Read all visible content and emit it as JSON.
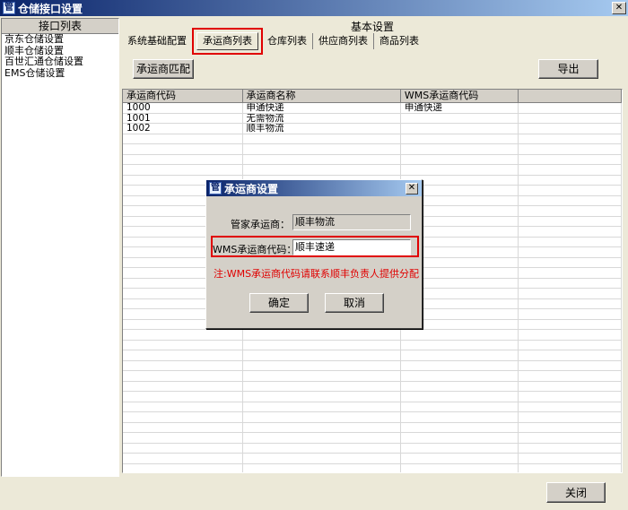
{
  "window": {
    "title": "仓储接口设置",
    "close_glyph": "✕"
  },
  "left_panel": {
    "header": "接口列表",
    "items": [
      "京东仓储设置",
      "顺丰仓储设置",
      "百世汇通仓储设置",
      "EMS仓储设置"
    ]
  },
  "main": {
    "section_title": "基本设置",
    "tabs": [
      {
        "label": "系统基础配置",
        "active": false
      },
      {
        "label": "承运商列表",
        "active": true
      },
      {
        "label": "仓库列表",
        "active": false
      },
      {
        "label": "供应商列表",
        "active": false
      },
      {
        "label": "商品列表",
        "active": false
      }
    ],
    "match_button": "承运商匹配",
    "export_button": "导出",
    "close_button": "关闭"
  },
  "table": {
    "columns": [
      "承运商代码",
      "承运商名称",
      "WMS承运商代码",
      ""
    ],
    "rows": [
      [
        "1000",
        "申通快递",
        "申通快递",
        ""
      ],
      [
        "1001",
        "无需物流",
        "",
        ""
      ],
      [
        "1002",
        "顺丰物流",
        "",
        ""
      ]
    ]
  },
  "dialog": {
    "title": "承运商设置",
    "close_glyph": "✕",
    "carrier_label": "管家承运商：",
    "carrier_value": "顺丰物流",
    "wms_code_label": "WMS承运商代码：",
    "wms_code_value": "顺丰速递",
    "note": "注:WMS承运商代码请联系顺丰负责人提供分配",
    "ok_button": "确定",
    "cancel_button": "取消"
  },
  "colors": {
    "highlight": "#e00000",
    "titlebar": "#0a246a",
    "face": "#d4d0c8"
  }
}
